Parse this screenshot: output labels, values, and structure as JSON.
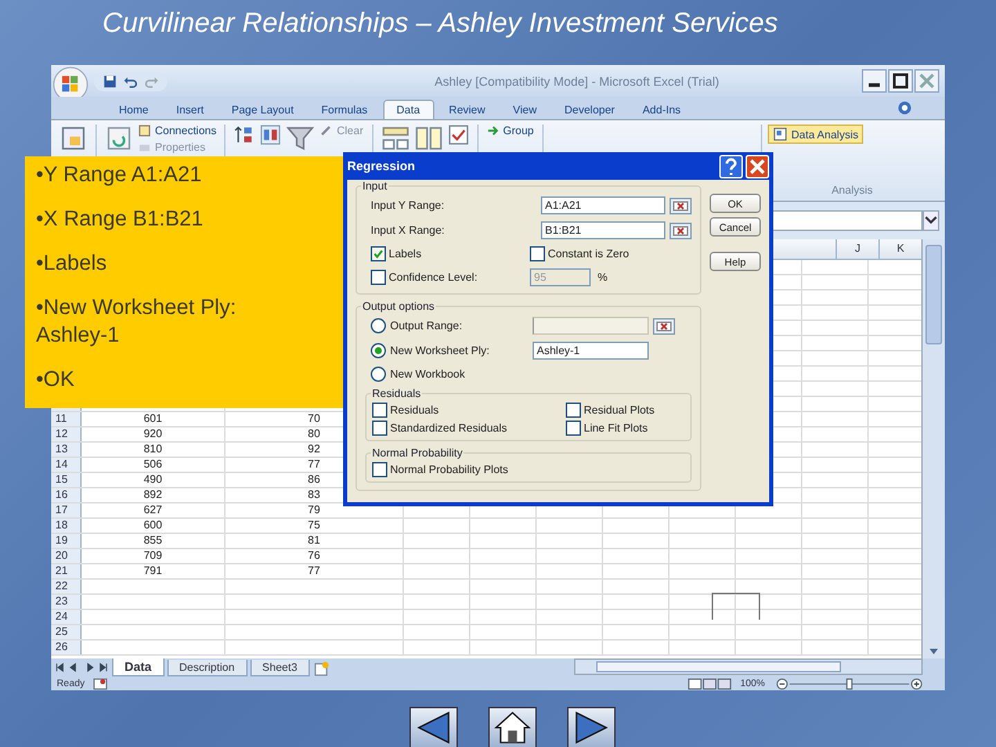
{
  "slide": {
    "title": "Curvilinear Relationships – Ashley Investment Services"
  },
  "excel": {
    "title": "Ashley  [Compatibility Mode] - Microsoft Excel (Trial)",
    "tabs": [
      {
        "label": "Home",
        "selected": false
      },
      {
        "label": "Insert",
        "selected": false
      },
      {
        "label": "Page Layout",
        "selected": false
      },
      {
        "label": "Formulas",
        "selected": false
      },
      {
        "label": "Data",
        "selected": true
      },
      {
        "label": "Review",
        "selected": false
      },
      {
        "label": "View",
        "selected": false
      },
      {
        "label": "Developer",
        "selected": false
      },
      {
        "label": "Add-Ins",
        "selected": false
      }
    ],
    "ribbon": {
      "connections": "Connections",
      "properties": "Properties",
      "clear": "Clear",
      "group": "Group",
      "data_analysis": "Data Analysis",
      "analysis_group": "Analysis"
    },
    "column_headers": [
      "J",
      "K"
    ],
    "rows": [
      {
        "number": "11",
        "a": "601",
        "b": "70"
      },
      {
        "number": "12",
        "a": "920",
        "b": "80"
      },
      {
        "number": "13",
        "a": "810",
        "b": "92"
      },
      {
        "number": "14",
        "a": "506",
        "b": "77"
      },
      {
        "number": "15",
        "a": "490",
        "b": "86"
      },
      {
        "number": "16",
        "a": "892",
        "b": "83"
      },
      {
        "number": "17",
        "a": "627",
        "b": "79"
      },
      {
        "number": "18",
        "a": "600",
        "b": "75"
      },
      {
        "number": "19",
        "a": "855",
        "b": "81"
      },
      {
        "number": "20",
        "a": "709",
        "b": "76"
      },
      {
        "number": "21",
        "a": "791",
        "b": "77"
      },
      {
        "number": "22"
      },
      {
        "number": "23"
      },
      {
        "number": "24"
      },
      {
        "number": "25"
      },
      {
        "number": "26"
      }
    ],
    "sheet_tabs": [
      {
        "label": "Data",
        "selected": true
      },
      {
        "label": "Description",
        "selected": false
      },
      {
        "label": "Sheet3",
        "selected": false
      }
    ],
    "status": {
      "text": "Ready",
      "zoom": "100%"
    }
  },
  "callout": {
    "items": [
      "•Y Range A1:A21",
      "•X Range B1:B21",
      "•Labels",
      "•New Worksheet Ply: Ashley-1",
      "•OK"
    ]
  },
  "dialog": {
    "title": "Regression",
    "input": {
      "legend": "Input",
      "y_label": "Input Y Range:",
      "y_value": "A1:A21",
      "x_label": "Input X Range:",
      "x_value": "B1:B21"
    },
    "checks": [
      {
        "label": "Labels",
        "checked": true
      },
      {
        "label": "Constant is Zero",
        "checked": false
      }
    ],
    "confidence": {
      "label": "Confidence Level:",
      "checked": false,
      "value": "95",
      "unit": "%"
    },
    "buttons": [
      "OK",
      "Cancel",
      "Help"
    ],
    "output": {
      "legend": "Output options",
      "options": [
        {
          "label": "Output Range:",
          "selected": false,
          "kind": "range"
        },
        {
          "label": "New Worksheet Ply:",
          "selected": true,
          "kind": "text",
          "value": "Ashley-1"
        },
        {
          "label": "New Workbook",
          "selected": false,
          "kind": "plain"
        }
      ]
    },
    "residuals": {
      "legend": "Residuals",
      "items": [
        {
          "label": "Residuals",
          "checked": false
        },
        {
          "label": "Residual Plots",
          "checked": false
        },
        {
          "label": "Standardized Residuals",
          "checked": false
        },
        {
          "label": "Line Fit Plots",
          "checked": false
        }
      ]
    },
    "normal": {
      "legend": "Normal Probability",
      "items": [
        {
          "label": "Normal Probability Plots",
          "checked": false
        }
      ]
    }
  }
}
